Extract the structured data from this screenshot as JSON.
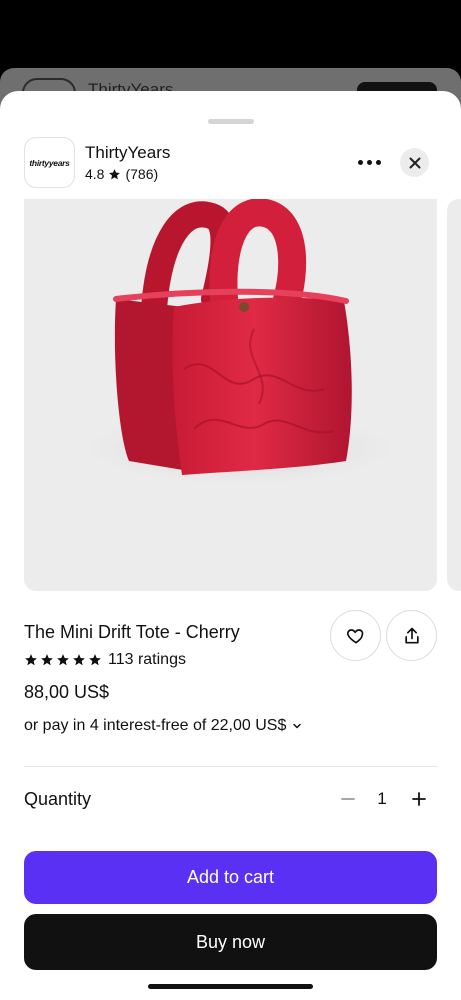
{
  "background_page": {
    "title": "ThirtyYears"
  },
  "shop": {
    "logo_text": "thirtyyears",
    "name": "ThirtyYears",
    "rating": "4.8",
    "review_count": "(786)"
  },
  "product": {
    "image_alt": "Red quilted mini tote bag",
    "title": "The Mini Drift Tote - Cherry",
    "stars": 5,
    "ratings_text": "113 ratings",
    "price": "88,00 US$",
    "installments": "or pay in 4 interest-free of 22,00 US$"
  },
  "quantity": {
    "label": "Quantity",
    "value": "1"
  },
  "actions": {
    "add_to_cart": "Add to cart",
    "buy_now": "Buy now"
  },
  "colors": {
    "accent": "#5a31f4",
    "product": "#d8203a",
    "dark": "#111111"
  },
  "icons": [
    "more-icon",
    "close-icon",
    "star-icon",
    "heart-icon",
    "share-icon",
    "chevron-down-icon",
    "minus-icon",
    "plus-icon"
  ]
}
